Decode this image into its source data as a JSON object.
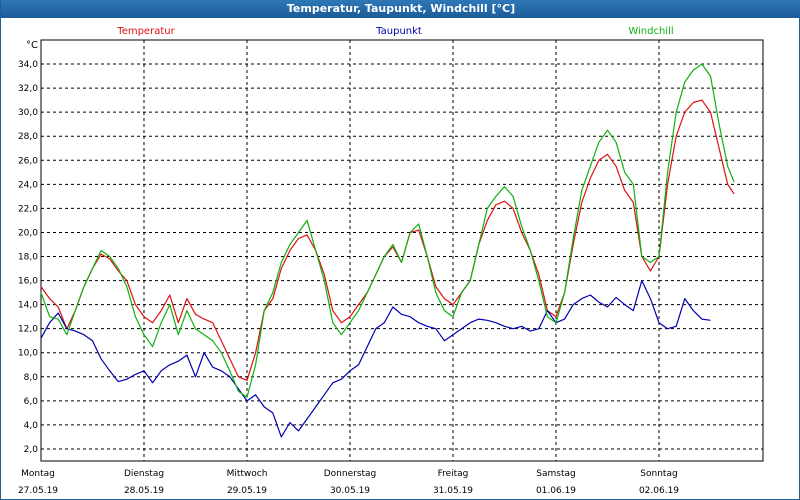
{
  "window": {
    "title": "Temperatur, Taupunkt, Windchill [°C]"
  },
  "chart_data": {
    "type": "line",
    "y_unit": "°C",
    "ylim": [
      1.0,
      36.0
    ],
    "y_ticks": [
      2.0,
      4.0,
      6.0,
      8.0,
      10.0,
      12.0,
      14.0,
      16.0,
      18.0,
      20.0,
      22.0,
      24.0,
      26.0,
      28.0,
      30.0,
      32.0,
      34.0
    ],
    "y_tick_labels": [
      "2,0",
      "4,0",
      "6,0",
      "8,0",
      "10,0",
      "12,0",
      "14,0",
      "16,0",
      "18,0",
      "20,0",
      "22,0",
      "24,0",
      "26,0",
      "28,0",
      "30,0",
      "32,0",
      "34,0"
    ],
    "grid": true,
    "xlim": [
      "27.05.19 00:00",
      "03.06.19 02:00"
    ],
    "days": [
      {
        "weekday": "Montag",
        "date": "27.05.19"
      },
      {
        "weekday": "Dienstag",
        "date": "28.05.19"
      },
      {
        "weekday": "Mittwoch",
        "date": "29.05.19"
      },
      {
        "weekday": "Donnerstag",
        "date": "30.05.19"
      },
      {
        "weekday": "Freitag",
        "date": "31.05.19"
      },
      {
        "weekday": "Samstag",
        "date": "01.06.19"
      },
      {
        "weekday": "Sonntag",
        "date": "02.06.19"
      }
    ],
    "series": [
      {
        "name": "Temperatur",
        "color": "#e01010",
        "values": [
          [
            "27.05.19 00:00",
            15.5
          ],
          [
            "27.05.19 02:00",
            14.5
          ],
          [
            "27.05.19 04:00",
            13.8
          ],
          [
            "27.05.19 06:00",
            12.0
          ],
          [
            "27.05.19 08:00",
            13.5
          ],
          [
            "27.05.19 10:00",
            15.5
          ],
          [
            "27.05.19 12:00",
            17.0
          ],
          [
            "27.05.19 14:00",
            18.2
          ],
          [
            "27.05.19 16:00",
            17.8
          ],
          [
            "27.05.19 18:00",
            16.8
          ],
          [
            "27.05.19 20:00",
            16.0
          ],
          [
            "27.05.19 22:00",
            14.0
          ],
          [
            "28.05.19 00:00",
            13.0
          ],
          [
            "28.05.19 02:00",
            12.5
          ],
          [
            "28.05.19 04:00",
            13.5
          ],
          [
            "28.05.19 06:00",
            14.8
          ],
          [
            "28.05.19 08:00",
            12.5
          ],
          [
            "28.05.19 10:00",
            14.5
          ],
          [
            "28.05.19 12:00",
            13.2
          ],
          [
            "28.05.19 14:00",
            12.8
          ],
          [
            "28.05.19 16:00",
            12.5
          ],
          [
            "28.05.19 18:00",
            11.0
          ],
          [
            "28.05.19 20:00",
            9.5
          ],
          [
            "28.05.19 22:00",
            8.0
          ],
          [
            "29.05.19 00:00",
            7.7
          ],
          [
            "29.05.19 02:00",
            10.0
          ],
          [
            "29.05.19 04:00",
            13.5
          ],
          [
            "29.05.19 06:00",
            14.5
          ],
          [
            "29.05.19 08:00",
            17.0
          ],
          [
            "29.05.19 10:00",
            18.5
          ],
          [
            "29.05.19 12:00",
            19.5
          ],
          [
            "29.05.19 14:00",
            19.8
          ],
          [
            "29.05.19 16:00",
            18.5
          ],
          [
            "29.05.19 18:00",
            16.5
          ],
          [
            "29.05.19 20:00",
            13.5
          ],
          [
            "29.05.19 22:00",
            12.5
          ],
          [
            "30.05.19 00:00",
            13.0
          ],
          [
            "30.05.19 02:00",
            14.0
          ],
          [
            "30.05.19 04:00",
            15.0
          ],
          [
            "30.05.19 06:00",
            16.5
          ],
          [
            "30.05.19 08:00",
            18.0
          ],
          [
            "30.05.19 10:00",
            18.8
          ],
          [
            "30.05.19 12:00",
            17.5
          ],
          [
            "30.05.19 14:00",
            20.0
          ],
          [
            "30.05.19 16:00",
            20.2
          ],
          [
            "30.05.19 18:00",
            18.0
          ],
          [
            "30.05.19 20:00",
            15.5
          ],
          [
            "30.05.19 22:00",
            14.5
          ],
          [
            "31.05.19 00:00",
            14.0
          ],
          [
            "31.05.19 02:00",
            15.0
          ],
          [
            "31.05.19 04:00",
            16.0
          ],
          [
            "31.05.19 06:00",
            19.0
          ],
          [
            "31.05.19 08:00",
            21.0
          ],
          [
            "31.05.19 10:00",
            22.3
          ],
          [
            "31.05.19 12:00",
            22.6
          ],
          [
            "31.05.19 14:00",
            22.0
          ],
          [
            "31.05.19 16:00",
            20.0
          ],
          [
            "31.05.19 18:00",
            18.5
          ],
          [
            "31.05.19 20:00",
            16.5
          ],
          [
            "31.05.19 22:00",
            13.5
          ],
          [
            "01.06.19 00:00",
            13.0
          ],
          [
            "01.06.19 02:00",
            15.0
          ],
          [
            "01.06.19 04:00",
            19.0
          ],
          [
            "01.06.19 06:00",
            22.5
          ],
          [
            "01.06.19 08:00",
            24.5
          ],
          [
            "01.06.19 10:00",
            26.0
          ],
          [
            "01.06.19 12:00",
            26.5
          ],
          [
            "01.06.19 14:00",
            25.5
          ],
          [
            "01.06.19 16:00",
            23.5
          ],
          [
            "01.06.19 18:00",
            22.5
          ],
          [
            "01.06.19 20:00",
            18.0
          ],
          [
            "01.06.19 22:00",
            16.8
          ],
          [
            "02.06.19 00:00",
            18.0
          ],
          [
            "02.06.19 02:00",
            24.0
          ],
          [
            "02.06.19 04:00",
            28.0
          ],
          [
            "02.06.19 06:00",
            30.0
          ],
          [
            "02.06.19 08:00",
            30.8
          ],
          [
            "02.06.19 10:00",
            31.0
          ],
          [
            "02.06.19 12:00",
            30.0
          ],
          [
            "02.06.19 14:00",
            27.0
          ],
          [
            "02.06.19 16:00",
            24.0
          ],
          [
            "02.06.19 17:30",
            23.2
          ]
        ]
      },
      {
        "name": "Taupunkt",
        "color": "#0000b0",
        "values": [
          [
            "27.05.19 00:00",
            11.2
          ],
          [
            "27.05.19 02:00",
            12.5
          ],
          [
            "27.05.19 04:00",
            13.3
          ],
          [
            "27.05.19 06:00",
            12.0
          ],
          [
            "27.05.19 08:00",
            11.8
          ],
          [
            "27.05.19 10:00",
            11.5
          ],
          [
            "27.05.19 12:00",
            11.0
          ],
          [
            "27.05.19 14:00",
            9.5
          ],
          [
            "27.05.19 16:00",
            8.5
          ],
          [
            "27.05.19 18:00",
            7.6
          ],
          [
            "27.05.19 20:00",
            7.8
          ],
          [
            "27.05.19 22:00",
            8.2
          ],
          [
            "28.05.19 00:00",
            8.5
          ],
          [
            "28.05.19 02:00",
            7.5
          ],
          [
            "28.05.19 04:00",
            8.5
          ],
          [
            "28.05.19 06:00",
            9.0
          ],
          [
            "28.05.19 08:00",
            9.3
          ],
          [
            "28.05.19 10:00",
            9.8
          ],
          [
            "28.05.19 12:00",
            8.0
          ],
          [
            "28.05.19 14:00",
            10.0
          ],
          [
            "28.05.19 16:00",
            8.8
          ],
          [
            "28.05.19 18:00",
            8.5
          ],
          [
            "28.05.19 20:00",
            8.0
          ],
          [
            "28.05.19 22:00",
            7.0
          ],
          [
            "29.05.19 00:00",
            6.0
          ],
          [
            "29.05.19 02:00",
            6.5
          ],
          [
            "29.05.19 04:00",
            5.5
          ],
          [
            "29.05.19 06:00",
            5.0
          ],
          [
            "29.05.19 08:00",
            3.0
          ],
          [
            "29.05.19 10:00",
            4.2
          ],
          [
            "29.05.19 12:00",
            3.5
          ],
          [
            "29.05.19 14:00",
            4.5
          ],
          [
            "29.05.19 16:00",
            5.5
          ],
          [
            "29.05.19 18:00",
            6.5
          ],
          [
            "29.05.19 20:00",
            7.5
          ],
          [
            "29.05.19 22:00",
            7.8
          ],
          [
            "30.05.19 00:00",
            8.5
          ],
          [
            "30.05.19 02:00",
            9.0
          ],
          [
            "30.05.19 04:00",
            10.5
          ],
          [
            "30.05.19 06:00",
            12.0
          ],
          [
            "30.05.19 08:00",
            12.5
          ],
          [
            "30.05.19 10:00",
            13.8
          ],
          [
            "30.05.19 12:00",
            13.2
          ],
          [
            "30.05.19 14:00",
            13.0
          ],
          [
            "30.05.19 16:00",
            12.5
          ],
          [
            "30.05.19 18:00",
            12.2
          ],
          [
            "30.05.19 20:00",
            12.0
          ],
          [
            "30.05.19 22:00",
            11.0
          ],
          [
            "31.05.19 00:00",
            11.5
          ],
          [
            "31.05.19 02:00",
            12.0
          ],
          [
            "31.05.19 04:00",
            12.5
          ],
          [
            "31.05.19 06:00",
            12.8
          ],
          [
            "31.05.19 08:00",
            12.7
          ],
          [
            "31.05.19 10:00",
            12.5
          ],
          [
            "31.05.19 12:00",
            12.2
          ],
          [
            "31.05.19 14:00",
            12.0
          ],
          [
            "31.05.19 16:00",
            12.2
          ],
          [
            "31.05.19 18:00",
            11.8
          ],
          [
            "31.05.19 20:00",
            12.0
          ],
          [
            "31.05.19 22:00",
            13.5
          ],
          [
            "01.06.19 00:00",
            12.5
          ],
          [
            "01.06.19 02:00",
            12.8
          ],
          [
            "01.06.19 04:00",
            14.0
          ],
          [
            "01.06.19 06:00",
            14.5
          ],
          [
            "01.06.19 08:00",
            14.8
          ],
          [
            "01.06.19 10:00",
            14.2
          ],
          [
            "01.06.19 12:00",
            13.8
          ],
          [
            "01.06.19 14:00",
            14.6
          ],
          [
            "01.06.19 16:00",
            14.0
          ],
          [
            "01.06.19 18:00",
            13.5
          ],
          [
            "01.06.19 20:00",
            16.0
          ],
          [
            "01.06.19 22:00",
            14.5
          ],
          [
            "02.06.19 00:00",
            12.5
          ],
          [
            "02.06.19 02:00",
            12.0
          ],
          [
            "02.06.19 04:00",
            12.2
          ],
          [
            "02.06.19 06:00",
            14.5
          ],
          [
            "02.06.19 08:00",
            13.5
          ],
          [
            "02.06.19 10:00",
            12.8
          ],
          [
            "02.06.19 12:00",
            12.7
          ]
        ]
      },
      {
        "name": "Windchill",
        "color": "#10b010",
        "values": [
          [
            "27.05.19 00:00",
            15.0
          ],
          [
            "27.05.19 02:00",
            13.0
          ],
          [
            "27.05.19 04:00",
            12.8
          ],
          [
            "27.05.19 06:00",
            11.5
          ],
          [
            "27.05.19 08:00",
            13.5
          ],
          [
            "27.05.19 10:00",
            15.5
          ],
          [
            "27.05.19 12:00",
            17.0
          ],
          [
            "27.05.19 14:00",
            18.5
          ],
          [
            "27.05.19 16:00",
            18.0
          ],
          [
            "27.05.19 18:00",
            17.0
          ],
          [
            "27.05.19 20:00",
            15.5
          ],
          [
            "27.05.19 22:00",
            13.0
          ],
          [
            "28.05.19 00:00",
            11.5
          ],
          [
            "28.05.19 02:00",
            10.5
          ],
          [
            "28.05.19 04:00",
            12.5
          ],
          [
            "28.05.19 06:00",
            14.0
          ],
          [
            "28.05.19 08:00",
            11.5
          ],
          [
            "28.05.19 10:00",
            13.5
          ],
          [
            "28.05.19 12:00",
            12.0
          ],
          [
            "28.05.19 14:00",
            11.5
          ],
          [
            "28.05.19 16:00",
            11.0
          ],
          [
            "28.05.19 18:00",
            10.0
          ],
          [
            "28.05.19 20:00",
            8.5
          ],
          [
            "28.05.19 22:00",
            6.8
          ],
          [
            "29.05.19 00:00",
            6.3
          ],
          [
            "29.05.19 02:00",
            9.0
          ],
          [
            "29.05.19 04:00",
            13.5
          ],
          [
            "29.05.19 06:00",
            15.0
          ],
          [
            "29.05.19 08:00",
            17.5
          ],
          [
            "29.05.19 10:00",
            19.0
          ],
          [
            "29.05.19 12:00",
            20.0
          ],
          [
            "29.05.19 14:00",
            21.0
          ],
          [
            "29.05.19 16:00",
            18.5
          ],
          [
            "29.05.19 18:00",
            16.0
          ],
          [
            "29.05.19 20:00",
            12.5
          ],
          [
            "29.05.19 22:00",
            11.5
          ],
          [
            "30.05.19 00:00",
            12.5
          ],
          [
            "30.05.19 02:00",
            13.5
          ],
          [
            "30.05.19 04:00",
            15.0
          ],
          [
            "30.05.19 06:00",
            16.5
          ],
          [
            "30.05.19 08:00",
            18.0
          ],
          [
            "30.05.19 10:00",
            19.0
          ],
          [
            "30.05.19 12:00",
            17.5
          ],
          [
            "30.05.19 14:00",
            20.0
          ],
          [
            "30.05.19 16:00",
            20.7
          ],
          [
            "30.05.19 18:00",
            18.0
          ],
          [
            "30.05.19 20:00",
            15.0
          ],
          [
            "30.05.19 22:00",
            13.5
          ],
          [
            "31.05.19 00:00",
            13.0
          ],
          [
            "31.05.19 02:00",
            15.0
          ],
          [
            "31.05.19 04:00",
            16.0
          ],
          [
            "31.05.19 06:00",
            19.0
          ],
          [
            "31.05.19 08:00",
            22.0
          ],
          [
            "31.05.19 10:00",
            23.0
          ],
          [
            "31.05.19 12:00",
            23.8
          ],
          [
            "31.05.19 14:00",
            23.0
          ],
          [
            "31.05.19 16:00",
            20.5
          ],
          [
            "31.05.19 18:00",
            18.5
          ],
          [
            "31.05.19 20:00",
            16.0
          ],
          [
            "31.05.19 22:00",
            13.0
          ],
          [
            "01.06.19 00:00",
            12.5
          ],
          [
            "01.06.19 02:00",
            15.0
          ],
          [
            "01.06.19 04:00",
            19.5
          ],
          [
            "01.06.19 06:00",
            23.5
          ],
          [
            "01.06.19 08:00",
            25.5
          ],
          [
            "01.06.19 10:00",
            27.5
          ],
          [
            "01.06.19 12:00",
            28.5
          ],
          [
            "01.06.19 14:00",
            27.5
          ],
          [
            "01.06.19 16:00",
            25.0
          ],
          [
            "01.06.19 18:00",
            24.0
          ],
          [
            "01.06.19 20:00",
            18.0
          ],
          [
            "01.06.19 22:00",
            17.5
          ],
          [
            "02.06.19 00:00",
            18.0
          ],
          [
            "02.06.19 02:00",
            25.0
          ],
          [
            "02.06.19 04:00",
            30.0
          ],
          [
            "02.06.19 06:00",
            32.5
          ],
          [
            "02.06.19 08:00",
            33.5
          ],
          [
            "02.06.19 10:00",
            34.0
          ],
          [
            "02.06.19 12:00",
            33.0
          ],
          [
            "02.06.19 14:00",
            29.0
          ],
          [
            "02.06.19 16:00",
            25.5
          ],
          [
            "02.06.19 17:30",
            24.2
          ]
        ]
      }
    ]
  }
}
